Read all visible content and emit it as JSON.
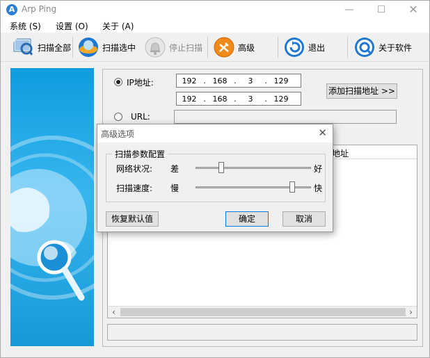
{
  "app": {
    "title": "Arp Ping",
    "icon": "arp-ping-app-icon"
  },
  "window_controls": {
    "minimize": "—",
    "maximize": "☐",
    "close": "✕"
  },
  "menu": [
    {
      "label": "系统 (S)"
    },
    {
      "label": "设置 (O)"
    },
    {
      "label": "关于 (A)"
    }
  ],
  "toolbar": {
    "scan_all": {
      "label": "扫描全部",
      "icon": "scan-all-icon"
    },
    "scan_selected": {
      "label": "扫描选中",
      "icon": "scan-selected-icon"
    },
    "stop_scan": {
      "label": "停止扫描",
      "icon": "stop-scan-icon"
    },
    "advanced": {
      "label": "高级",
      "icon": "advanced-icon"
    },
    "exit": {
      "label": "退出",
      "icon": "exit-icon"
    },
    "about": {
      "label": "关于软件",
      "icon": "about-icon"
    }
  },
  "main": {
    "ip_radio_label": "IP地址:",
    "ip_start": [
      "192",
      "168",
      "3",
      "129"
    ],
    "ip_end": [
      "192",
      "168",
      "3",
      "129"
    ],
    "add_scan_button": "添加扫描地址 >>",
    "url_radio_label": "URL:",
    "url_value": "",
    "list_header_partial": "地址"
  },
  "dialog": {
    "title": "高级选项",
    "group_title": "扫描参数配置",
    "network_label": "网络状况:",
    "network_min": "差",
    "network_max": "好",
    "network_value": 0.2,
    "speed_label": "扫描速度:",
    "speed_min": "慢",
    "speed_max": "快",
    "speed_value": 0.85,
    "restore_button": "恢复默认值",
    "ok_button": "确定",
    "cancel_button": "取消"
  },
  "colors": {
    "accent_blue": "#0e9ce0",
    "toolbar_orange": "#f08a1a",
    "toolbar_blue": "#1e78d2"
  }
}
